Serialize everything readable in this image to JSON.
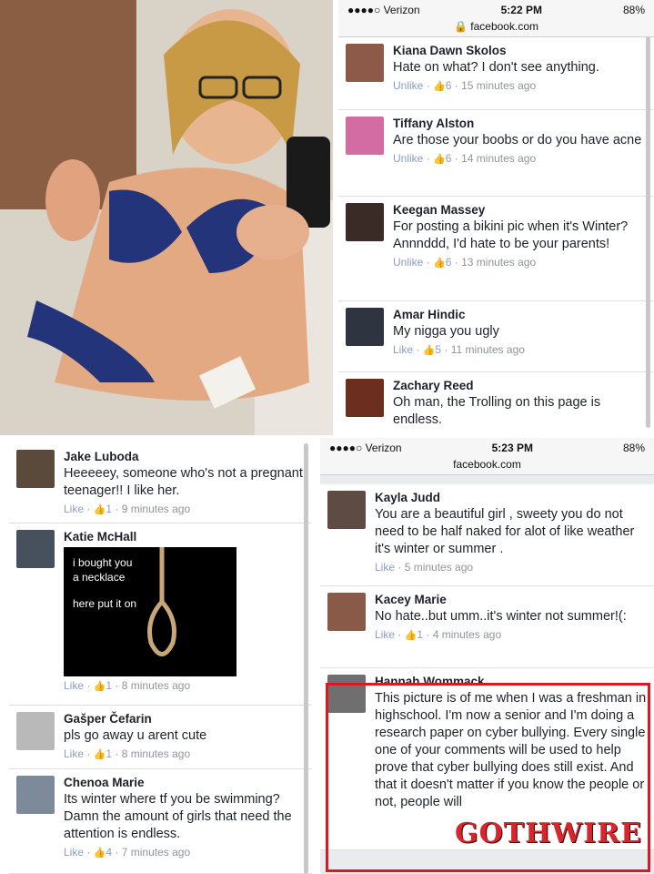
{
  "panel_tr": {
    "status": {
      "carrier": "●●●●○ Verizon",
      "time": "5:22 PM",
      "battery": "88%"
    },
    "url": "facebook.com",
    "comments": [
      {
        "name": "Kiana Dawn Skolos",
        "text": "Hate on what? I don't see anything.",
        "action": "Unlike",
        "likes": "6",
        "time": "15 minutes ago",
        "avatar_color": "#8d5a4a"
      },
      {
        "name": "Tiffany Alston",
        "text": "Are those your boobs or do you have acne",
        "action": "Unlike",
        "likes": "6",
        "time": "14 minutes ago",
        "avatar_color": "#d26ca2"
      },
      {
        "name": "Keegan Massey",
        "text": "For posting a bikini pic when it's Winter? Annnddd, I'd hate to be your parents!",
        "action": "Unlike",
        "likes": "6",
        "time": "13 minutes ago",
        "avatar_color": "#3a2b26"
      },
      {
        "name": "Amar Hindic",
        "text": "My nigga you ugly",
        "action": "Like",
        "likes": "5",
        "time": "11 minutes ago",
        "avatar_color": "#2e3440"
      },
      {
        "name": "Zachary Reed",
        "text": "Oh man, the Trolling on this page is endless.",
        "action": "",
        "likes": "",
        "time": "",
        "avatar_color": "#6b2e1f"
      }
    ]
  },
  "panel_bl": {
    "comments": [
      {
        "name": "Jake Luboda",
        "text": "Heeeeey, someone who's not a pregnant teenager!! I like her.",
        "action": "Like",
        "likes": "1",
        "time": "9 minutes ago",
        "avatar_color": "#5a4a3c"
      },
      {
        "name": "Katie McHall",
        "text": "",
        "action": "Like",
        "likes": "1",
        "time": "8 minutes ago",
        "avatar_color": "#47515e",
        "image": {
          "line1": "i bought you",
          "line2": "a necklace",
          "line3": "here put it on"
        }
      },
      {
        "name": "Gašper Čefarin",
        "text": "pls go away u arent cute",
        "action": "Like",
        "likes": "1",
        "time": "8 minutes ago",
        "avatar_color": "#b9b9b9"
      },
      {
        "name": "Chenoa Marie",
        "text": "Its winter where tf you be swimming? Damn the amount of girls that need the attention is endless.",
        "action": "Like",
        "likes": "4",
        "time": "7 minutes ago",
        "avatar_color": "#7c8a9a"
      }
    ]
  },
  "panel_br": {
    "status": {
      "carrier": "●●●●○ Verizon",
      "time": "5:23 PM",
      "battery": "88%"
    },
    "url": "facebook.com",
    "comments": [
      {
        "name": "Kayla Judd",
        "text": "You are a beautiful girl , sweety you do not need to be half naked for alot of like weather it's winter or summer .",
        "action": "Like",
        "likes": "",
        "time": "5 minutes ago",
        "avatar_color": "#5e4b43"
      },
      {
        "name": "Kacey Marie",
        "text": "No hate..but umm..it's winter not summer!(:",
        "action": "Like",
        "likes": "1",
        "time": "4 minutes ago",
        "avatar_color": "#8a5a48"
      },
      {
        "name": "Hannah Wommack",
        "text": "This picture is of me when I was a freshman in highschool. I'm now a senior and I'm doing a research paper on cyber bullying. Every single one of your comments will be used to help prove that cyber bullying does still exist. And that it doesn't matter if you know the people or not, people will",
        "action": "",
        "likes": "",
        "time": "",
        "avatar_color": "#6f6f6f"
      }
    ]
  },
  "watermark": "GOTHWIRE",
  "colors": {
    "highlight": "#d21d24",
    "link": "#8b9dc3",
    "meta": "#90949c"
  }
}
